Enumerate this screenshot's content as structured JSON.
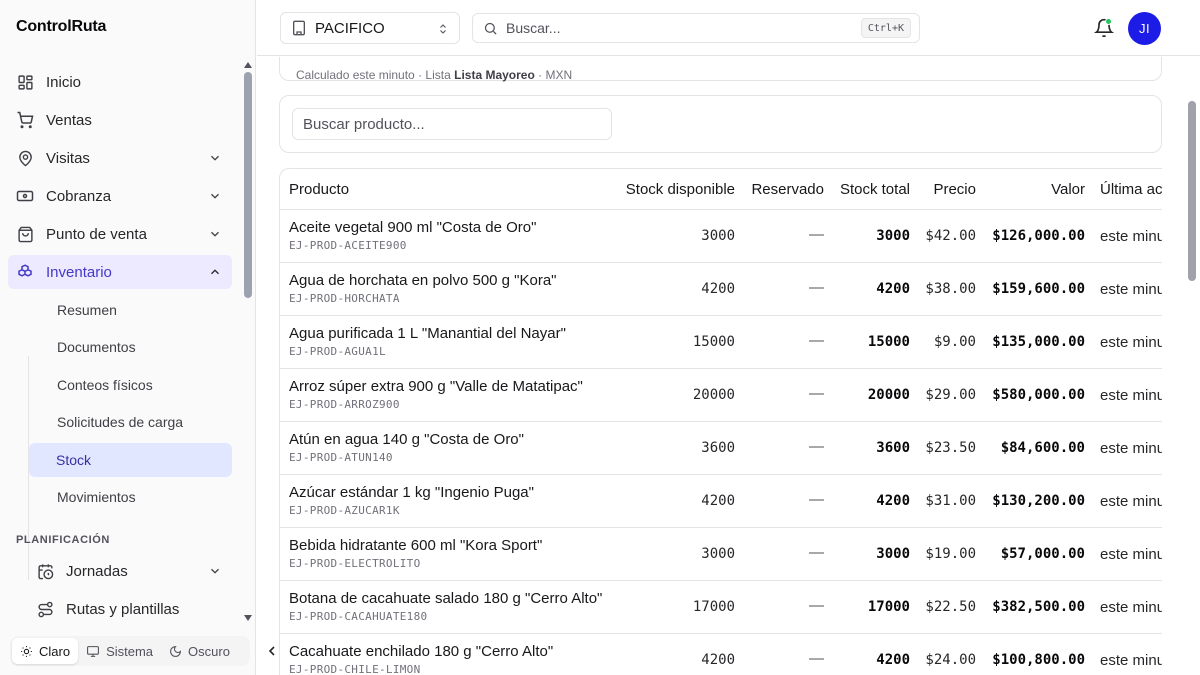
{
  "app": {
    "brand": "ControlRuta"
  },
  "sidebar": {
    "nav": [
      {
        "label": "Inicio",
        "icon": "dashboard-icon"
      },
      {
        "label": "Ventas",
        "icon": "cart-icon"
      },
      {
        "label": "Visitas",
        "icon": "map-pin-icon"
      },
      {
        "label": "Cobranza",
        "icon": "banknote-icon"
      },
      {
        "label": "Punto de venta",
        "icon": "store-icon"
      },
      {
        "label": "Inventario",
        "icon": "boxes-icon"
      }
    ],
    "inventory_sub": [
      "Resumen",
      "Documentos",
      "Conteos físicos",
      "Solicitudes de carga",
      "Stock",
      "Movimientos"
    ],
    "section_label": "PLANIFICACIÓN",
    "planning": [
      {
        "label": "Jornadas",
        "icon": "calendar-clock-icon"
      },
      {
        "label": "Rutas y plantillas",
        "icon": "route-icon"
      }
    ],
    "theme": {
      "light": "Claro",
      "system": "Sistema",
      "dark": "Oscuro"
    }
  },
  "header": {
    "branch": "PACIFICO",
    "search_placeholder": "Buscar...",
    "shortcut": "Ctrl+K",
    "avatar_initials": "JI"
  },
  "summary": {
    "calculated": "Calculado este minuto",
    "list_prefix": "Lista",
    "list_name": "Lista Mayoreo",
    "currency": "MXN"
  },
  "filters": {
    "product_search_placeholder": "Buscar producto..."
  },
  "table": {
    "columns": [
      "Producto",
      "Stock disponible",
      "Reservado",
      "Stock total",
      "Precio",
      "Valor",
      "Última ac"
    ],
    "rows": [
      {
        "name": "Aceite vegetal 900 ml \"Costa de Oro\"",
        "sku": "EJ-PROD-ACEITE900",
        "available": "3000",
        "reserved": "—",
        "total": "3000",
        "price": "$42.00",
        "value": "$126,000.00",
        "last": "este minu"
      },
      {
        "name": "Agua de horchata en polvo 500 g \"Kora\"",
        "sku": "EJ-PROD-HORCHATA",
        "available": "4200",
        "reserved": "—",
        "total": "4200",
        "price": "$38.00",
        "value": "$159,600.00",
        "last": "este minu"
      },
      {
        "name": "Agua purificada 1 L \"Manantial del Nayar\"",
        "sku": "EJ-PROD-AGUA1L",
        "available": "15000",
        "reserved": "—",
        "total": "15000",
        "price": "$9.00",
        "value": "$135,000.00",
        "last": "este minu"
      },
      {
        "name": "Arroz súper extra 900 g \"Valle de Matatipac\"",
        "sku": "EJ-PROD-ARROZ900",
        "available": "20000",
        "reserved": "—",
        "total": "20000",
        "price": "$29.00",
        "value": "$580,000.00",
        "last": "este minu"
      },
      {
        "name": "Atún en agua 140 g \"Costa de Oro\"",
        "sku": "EJ-PROD-ATUN140",
        "available": "3600",
        "reserved": "—",
        "total": "3600",
        "price": "$23.50",
        "value": "$84,600.00",
        "last": "este minu"
      },
      {
        "name": "Azúcar estándar 1 kg \"Ingenio Puga\"",
        "sku": "EJ-PROD-AZUCAR1K",
        "available": "4200",
        "reserved": "—",
        "total": "4200",
        "price": "$31.00",
        "value": "$130,200.00",
        "last": "este minu"
      },
      {
        "name": "Bebida hidratante 600 ml \"Kora Sport\"",
        "sku": "EJ-PROD-ELECTROLITO",
        "available": "3000",
        "reserved": "—",
        "total": "3000",
        "price": "$19.00",
        "value": "$57,000.00",
        "last": "este minu"
      },
      {
        "name": "Botana de cacahuate salado 180 g \"Cerro Alto\"",
        "sku": "EJ-PROD-CACAHUATE180",
        "available": "17000",
        "reserved": "—",
        "total": "17000",
        "price": "$22.50",
        "value": "$382,500.00",
        "last": "este minu"
      },
      {
        "name": "Cacahuate enchilado 180 g \"Cerro Alto\"",
        "sku": "EJ-PROD-CHILE-LIMON",
        "available": "4200",
        "reserved": "—",
        "total": "4200",
        "price": "$24.00",
        "value": "$100,800.00",
        "last": "este minu"
      }
    ]
  }
}
